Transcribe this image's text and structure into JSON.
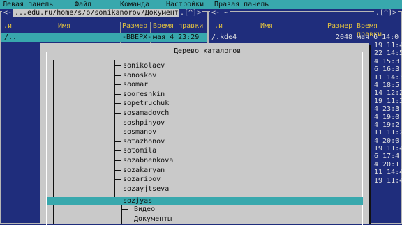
{
  "menu": {
    "left_panel": "Левая панель",
    "file": "Файл",
    "command": "Команда",
    "settings": "Настройки",
    "right_panel": "Правая панель"
  },
  "left_panel": {
    "history_left": "<-",
    "path": " ...edu.ru/home/s/o/sonikanorov/Документы ",
    "history_right": ".[^]>",
    "col_sort": ".и",
    "col_name": "Имя",
    "col_size": "Размер",
    "col_mtime": "Время правки",
    "rows": [
      {
        "name": "/..",
        "size": "-ВВЕРХ-",
        "mtime": "мая   4 23:29"
      }
    ]
  },
  "right_panel": {
    "history_left": "<- ~",
    "history_right": ".[^]>",
    "col_sort": ".и",
    "col_name": "Имя",
    "col_size": "Размер",
    "col_mtime": "Время правки",
    "rows": [
      {
        "name": "/.kde4",
        "size": "2048",
        "mtime": "мая   6 14:0"
      }
    ],
    "time_column": [
      "19 11:4",
      "22 14:5",
      "4 15:3",
      "6 16:3",
      "11 14:3",
      "4 18:5",
      "14 12:2",
      "19 11:3",
      "4 23:3",
      "4 19:0",
      "4 19:2",
      "11 11:2",
      "4 20:0",
      "19 11:4",
      "6 17:4",
      "4 20:1",
      "11 14:4",
      "19 11:4"
    ]
  },
  "dialog": {
    "title": "Дерево каталогов",
    "items": [
      "sonikolaev",
      "sonoskov",
      "soomar",
      "sooreshkin",
      "sopetruchuk",
      "sosamadovch",
      "soshpinyov",
      "sosmanov",
      "sotazhonov",
      "sotomila",
      "sozabnenkova",
      "sozakaryan",
      "sozaripov",
      "sozayjtseva",
      "sozjyas"
    ],
    "selected": "sozjyas",
    "children": [
      "Видео",
      "Документы"
    ]
  },
  "colors": {
    "panel_bg": "#1f2d7c",
    "accent_cyan": "#38a8ad",
    "dialog_bg": "#c9c9c9",
    "header_yellow": "#e0c040"
  }
}
